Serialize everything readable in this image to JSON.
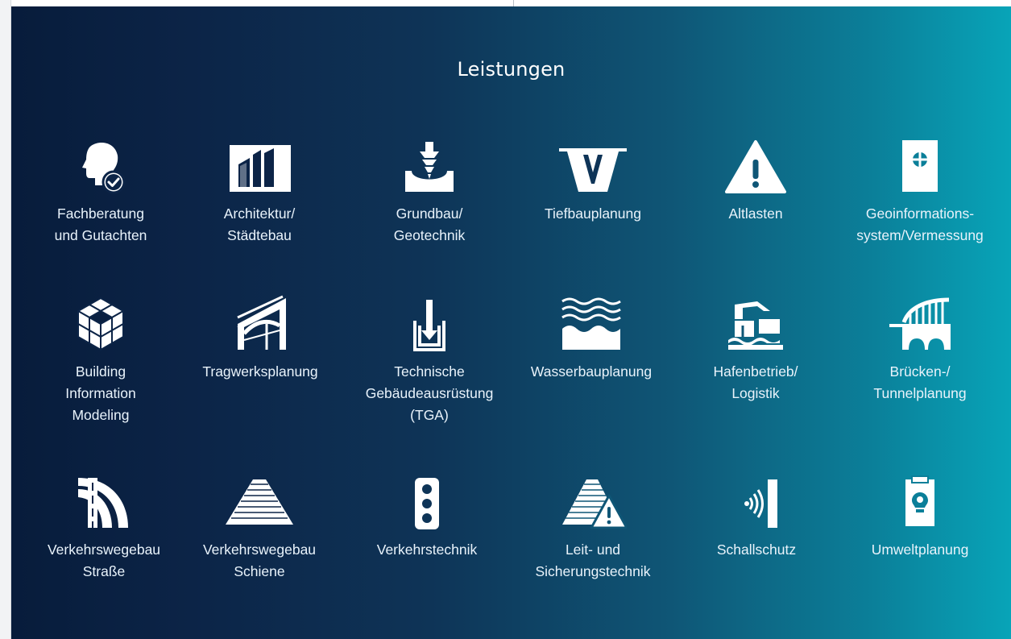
{
  "section": {
    "title": "Leistungen"
  },
  "services": [
    {
      "icon": "consulting-head-check-icon",
      "label": "Fachberatung\nund Gutachten"
    },
    {
      "icon": "architecture-buildings-icon",
      "label": "Architektur/\nStädtebau"
    },
    {
      "icon": "foundation-drill-icon",
      "label": "Grundbau/\nGeotechnik"
    },
    {
      "icon": "civil-engineering-trench-icon",
      "label": "Tiefbauplanung"
    },
    {
      "icon": "warning-triangle-icon",
      "label": "Altlasten"
    },
    {
      "icon": "survey-marker-icon",
      "label": "Geoinformations-\nsystem/Vermessung"
    },
    {
      "icon": "bim-cubes-icon",
      "label": "Building\nInformation\nModeling"
    },
    {
      "icon": "structural-frame-icon",
      "label": "Tragwerksplanung"
    },
    {
      "icon": "building-services-icon",
      "label": "Technische\nGebäudeausrüstung\n(TGA)"
    },
    {
      "icon": "water-waves-icon",
      "label": "Wasserbauplanung"
    },
    {
      "icon": "harbor-crane-icon",
      "label": "Hafenbetrieb/\nLogistik"
    },
    {
      "icon": "bridge-arch-icon",
      "label": "Brücken-/\nTunnelplanung"
    },
    {
      "icon": "road-curve-icon",
      "label": "Verkehrswegebau\nStraße"
    },
    {
      "icon": "rail-track-icon",
      "label": "Verkehrswegebau\nSchiene"
    },
    {
      "icon": "traffic-light-icon",
      "label": "Verkehrstechnik"
    },
    {
      "icon": "rail-warning-icon",
      "label": "Leit- und\nSicherungstechnik"
    },
    {
      "icon": "sound-barrier-icon",
      "label": "Schallschutz"
    },
    {
      "icon": "environmental-clipboard-icon",
      "label": "Umweltplanung"
    }
  ]
}
